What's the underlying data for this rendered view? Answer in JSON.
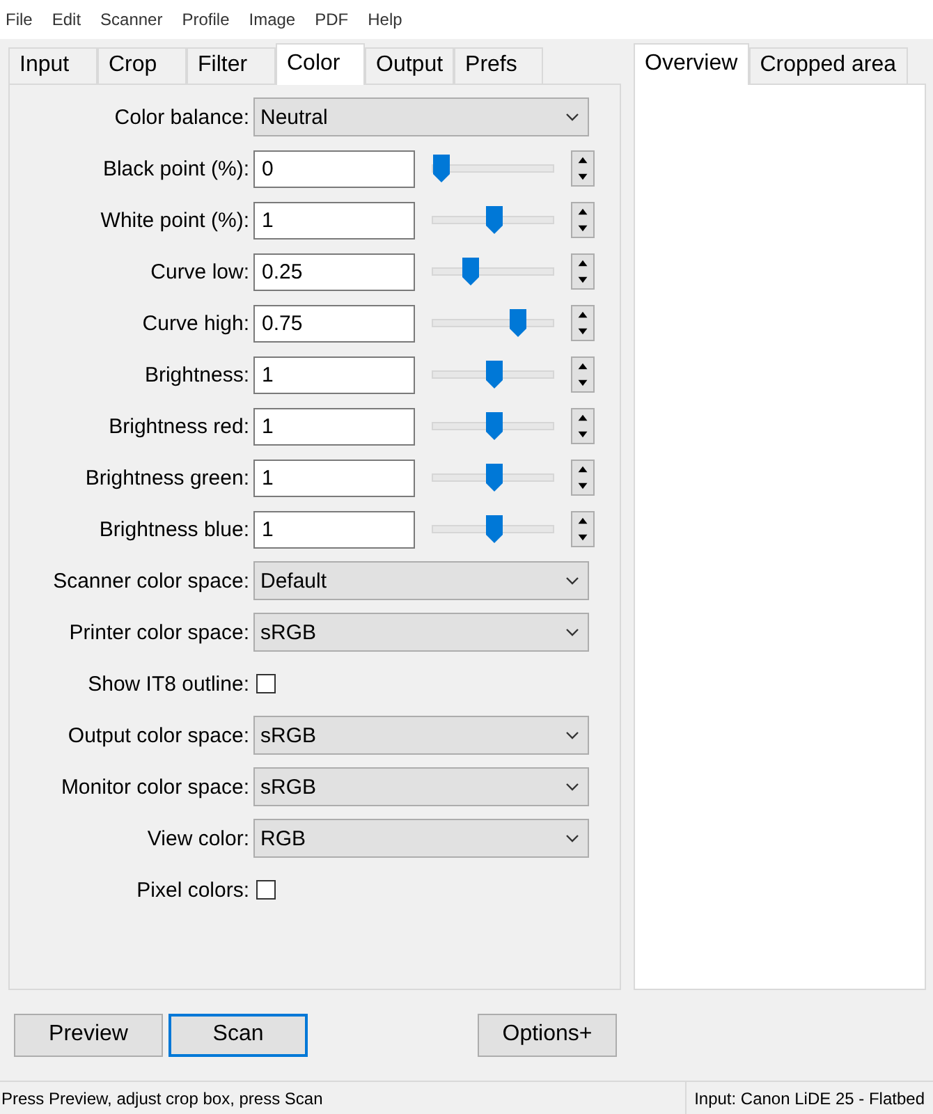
{
  "menu": [
    "File",
    "Edit",
    "Scanner",
    "Profile",
    "Image",
    "PDF",
    "Help"
  ],
  "left_tabs": [
    {
      "label": "Input",
      "selected": false
    },
    {
      "label": "Crop",
      "selected": false
    },
    {
      "label": "Filter",
      "selected": false
    },
    {
      "label": "Color",
      "selected": true
    },
    {
      "label": "Output",
      "selected": false
    },
    {
      "label": "Prefs",
      "selected": false
    }
  ],
  "rows": [
    {
      "kind": "select",
      "label": "Color balance:",
      "value": "Neutral"
    },
    {
      "kind": "slider",
      "label": "Black point (%):",
      "value": "0",
      "level": 0
    },
    {
      "kind": "slider",
      "label": "White point (%):",
      "value": "1",
      "level": 0.5
    },
    {
      "kind": "slider",
      "label": "Curve low:",
      "value": "0.25",
      "level": 0.27
    },
    {
      "kind": "slider",
      "label": "Curve high:",
      "value": "0.75",
      "level": 0.72
    },
    {
      "kind": "slider",
      "label": "Brightness:",
      "value": "1",
      "level": 0.5
    },
    {
      "kind": "slider",
      "label": "Brightness red:",
      "value": "1",
      "level": 0.5
    },
    {
      "kind": "slider",
      "label": "Brightness green:",
      "value": "1",
      "level": 0.5
    },
    {
      "kind": "slider",
      "label": "Brightness blue:",
      "value": "1",
      "level": 0.5
    },
    {
      "kind": "select",
      "label": "Scanner color space:",
      "value": "Default"
    },
    {
      "kind": "select",
      "label": "Printer color space:",
      "value": "sRGB"
    },
    {
      "kind": "checkbox",
      "label": "Show IT8 outline:",
      "checked": false
    },
    {
      "kind": "select",
      "label": "Output color space:",
      "value": "sRGB"
    },
    {
      "kind": "select",
      "label": "Monitor color space:",
      "value": "sRGB"
    },
    {
      "kind": "select",
      "label": "View color:",
      "value": "RGB"
    },
    {
      "kind": "checkbox",
      "label": "Pixel colors:",
      "checked": false
    }
  ],
  "right_tabs": [
    {
      "label": "Overview",
      "selected": true
    },
    {
      "label": "Cropped area",
      "selected": false
    }
  ],
  "buttons": [
    {
      "label": "Preview",
      "focused": false
    },
    {
      "label": "Scan",
      "focused": true
    },
    {
      "label": "Options+",
      "focused": false
    }
  ],
  "status_bar": {
    "message": "Press Preview, adjust crop box, press Scan",
    "device": "Input: Canon LiDE 25 - Flatbed"
  }
}
